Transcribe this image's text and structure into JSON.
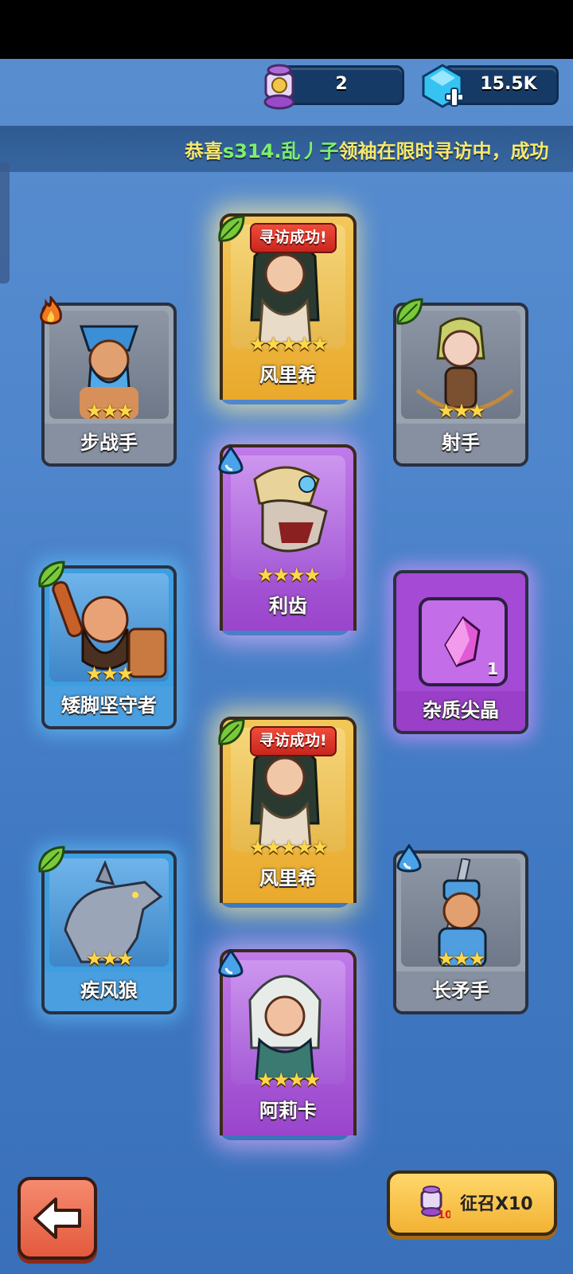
{
  "currency": {
    "scrolls": "2",
    "gems": "15.5K"
  },
  "marquee": {
    "prefix": "恭喜",
    "player": "s314.乱丿子",
    "rest": "领袖在限时寻访中，成功"
  },
  "cards": {
    "infantry": {
      "name": "步战手",
      "stars": "★★★",
      "element": "fire-icon"
    },
    "archer": {
      "name": "射手",
      "stars": "★★★",
      "element": "leaf-icon"
    },
    "dwarf": {
      "name": "矮脚坚守者",
      "stars": "★★★",
      "element": "leaf-icon"
    },
    "crystal": {
      "name": "杂质尖晶",
      "count": "1"
    },
    "wolf": {
      "name": "疾风狼",
      "stars": "★★★",
      "element": "leaf-icon"
    },
    "spear": {
      "name": "长矛手",
      "stars": "★★★",
      "element": "water-icon"
    }
  },
  "shields": {
    "top": {
      "name": "风里希",
      "stars": "★★★★★",
      "banner": "寻访成功!",
      "element": "leaf-icon"
    },
    "fang": {
      "name": "利齿",
      "stars": "★★★★",
      "element": "water-icon"
    },
    "middle": {
      "name": "风里希",
      "stars": "★★★★★",
      "banner": "寻访成功!",
      "element": "leaf-icon"
    },
    "arika": {
      "name": "阿莉卡",
      "stars": "★★★★",
      "element": "water-icon"
    }
  },
  "buttons": {
    "recruit_label": "征召X10",
    "recruit_badge": "10"
  },
  "colors": {
    "gold": "#f5b634",
    "purple": "#a44ad4",
    "blue": "#3d9ee0",
    "gray": "#9aa3b0",
    "marquee_text": "#f7e86a",
    "marquee_highlight": "#7df06b"
  }
}
